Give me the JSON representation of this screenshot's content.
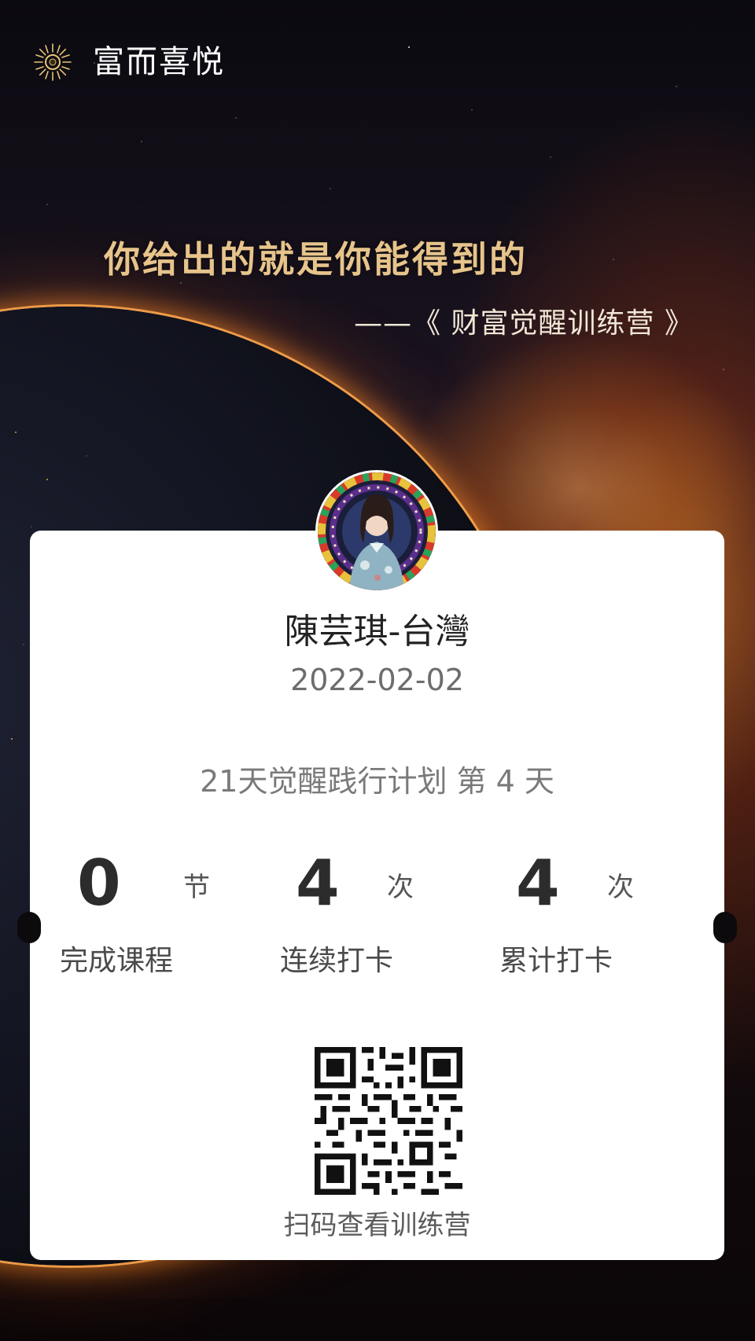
{
  "brand": {
    "name": "富而喜悦",
    "icon": "sunburst-logo-icon"
  },
  "hero": {
    "quote": "你给出的就是你能得到的",
    "source": "——《 财富觉醒训练营 》"
  },
  "card": {
    "user_name": "陳芸琪-台灣",
    "date": "2022-02-02",
    "plan": "21天觉醒践行计划 第 4 天",
    "stats": [
      {
        "value": "0",
        "unit": "节",
        "label": "完成课程"
      },
      {
        "value": "4",
        "unit": "次",
        "label": "连续打卡"
      },
      {
        "value": "4",
        "unit": "次",
        "label": "累计打卡"
      }
    ],
    "qr_caption": "扫码查看训练营"
  },
  "colors": {
    "quote_gold": "#e7c48b",
    "card_bg": "#ffffff",
    "glow": "#ff8c28"
  }
}
